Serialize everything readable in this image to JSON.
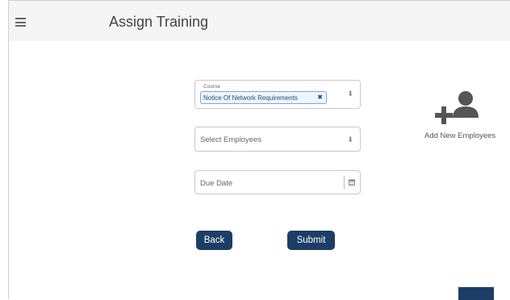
{
  "header": {
    "title": "Assign Training",
    "menu_icon": "hamburger-icon"
  },
  "form": {
    "course": {
      "label": "Course",
      "selected": "Notice Of Network Requirements",
      "remove_glyph": "✖",
      "arrow_icon": "caret-down-icon"
    },
    "employees": {
      "placeholder": "Select Employees",
      "arrow_icon": "caret-down-icon"
    },
    "due_date": {
      "placeholder": "Due Date",
      "icon": "calendar-icon"
    }
  },
  "buttons": {
    "back": "Back",
    "submit": "Submit"
  },
  "add_employees": {
    "label": "Add New Employees",
    "icon": "add-person-icon"
  },
  "colors": {
    "primary": "#1c3e66",
    "header_bg": "#f5f5f5",
    "chip_border": "#7aa7d6"
  }
}
